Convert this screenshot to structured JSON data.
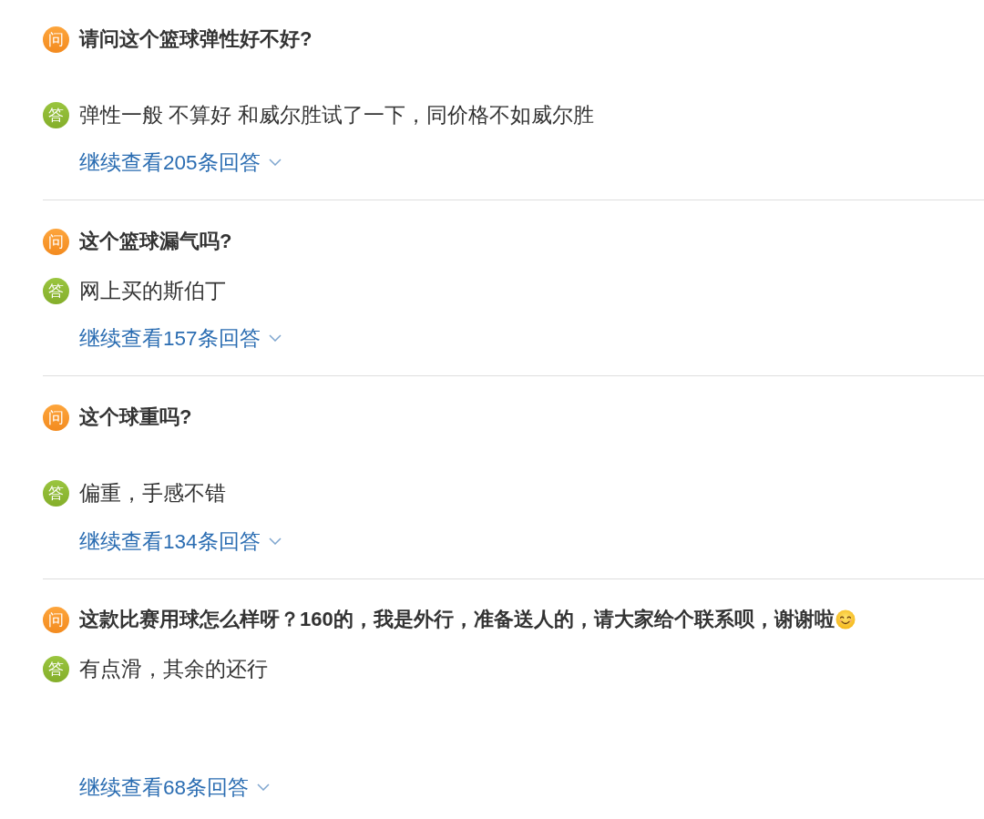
{
  "qa_items": [
    {
      "question": {
        "badge": "问",
        "text": "请问这个篮球弹性好不好?"
      },
      "answer": {
        "badge": "答",
        "text": "弹性一般 不算好 和威尔胜试了一下，同价格不如威尔胜"
      },
      "more_link": "继续查看205条回答"
    },
    {
      "question": {
        "badge": "问",
        "text": "这个篮球漏气吗?"
      },
      "answer": {
        "badge": "答",
        "text": "网上买的斯伯丁"
      },
      "more_link": "继续查看157条回答"
    },
    {
      "question": {
        "badge": "问",
        "text": "这个球重吗?"
      },
      "answer": {
        "badge": "答",
        "text": "偏重，手感不错"
      },
      "more_link": "继续查看134条回答"
    },
    {
      "question": {
        "badge": "问",
        "text": "这款比赛用球怎么样呀？160的，我是外行，准备送人的，请大家给个联系呗，谢谢啦",
        "emoji": true
      },
      "answer": {
        "badge": "答",
        "text": "有点滑，其余的还行"
      },
      "more_link": "继续查看68条回答"
    }
  ]
}
